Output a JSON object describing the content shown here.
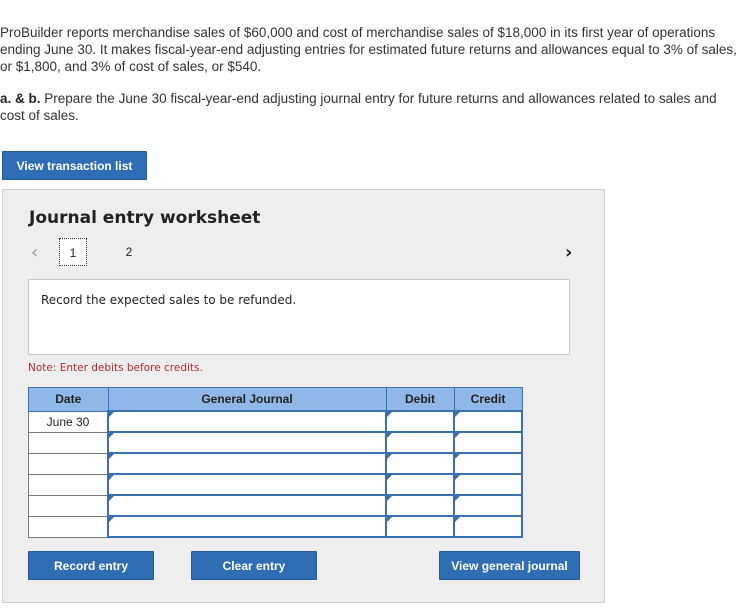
{
  "intro_text": "ProBuilder reports merchandise sales of $60,000 and cost of merchandise sales of $18,000 in its first year of operations ending June 30. It makes fiscal-year-end adjusting entries for estimated future returns and allowances equal to 3% of sales, or $1,800, and 3% of cost of sales, or $540.",
  "task": {
    "prefix": "a. & b.",
    "text": " Prepare the June 30 fiscal-year-end adjusting journal entry for future returns and allowances related to sales and cost of sales."
  },
  "buttons": {
    "view_transactions": "View transaction list",
    "record_entry": "Record entry",
    "clear_entry": "Clear entry",
    "view_general_journal": "View general journal"
  },
  "worksheet": {
    "title": "Journal entry worksheet",
    "prev_icon": "chevron-left-icon",
    "next_icon": "chevron-right-icon",
    "pages": [
      "1",
      "2"
    ],
    "current_page": "1",
    "description": "Record the expected sales to be refunded.",
    "note": "Note: Enter debits before credits."
  },
  "journal": {
    "headers": {
      "date": "Date",
      "general_journal": "General Journal",
      "debit": "Debit",
      "credit": "Credit"
    },
    "rows": [
      {
        "date": "June 30",
        "account": "",
        "debit": "",
        "credit": ""
      },
      {
        "date": "",
        "account": "",
        "debit": "",
        "credit": ""
      },
      {
        "date": "",
        "account": "",
        "debit": "",
        "credit": ""
      },
      {
        "date": "",
        "account": "",
        "debit": "",
        "credit": ""
      },
      {
        "date": "",
        "account": "",
        "debit": "",
        "credit": ""
      },
      {
        "date": "",
        "account": "",
        "debit": "",
        "credit": ""
      }
    ]
  },
  "colors": {
    "button_blue": "#2f6eb5",
    "header_blue": "#8fb8e8",
    "note_red": "#b03030",
    "panel_gray": "#eeeeee"
  }
}
